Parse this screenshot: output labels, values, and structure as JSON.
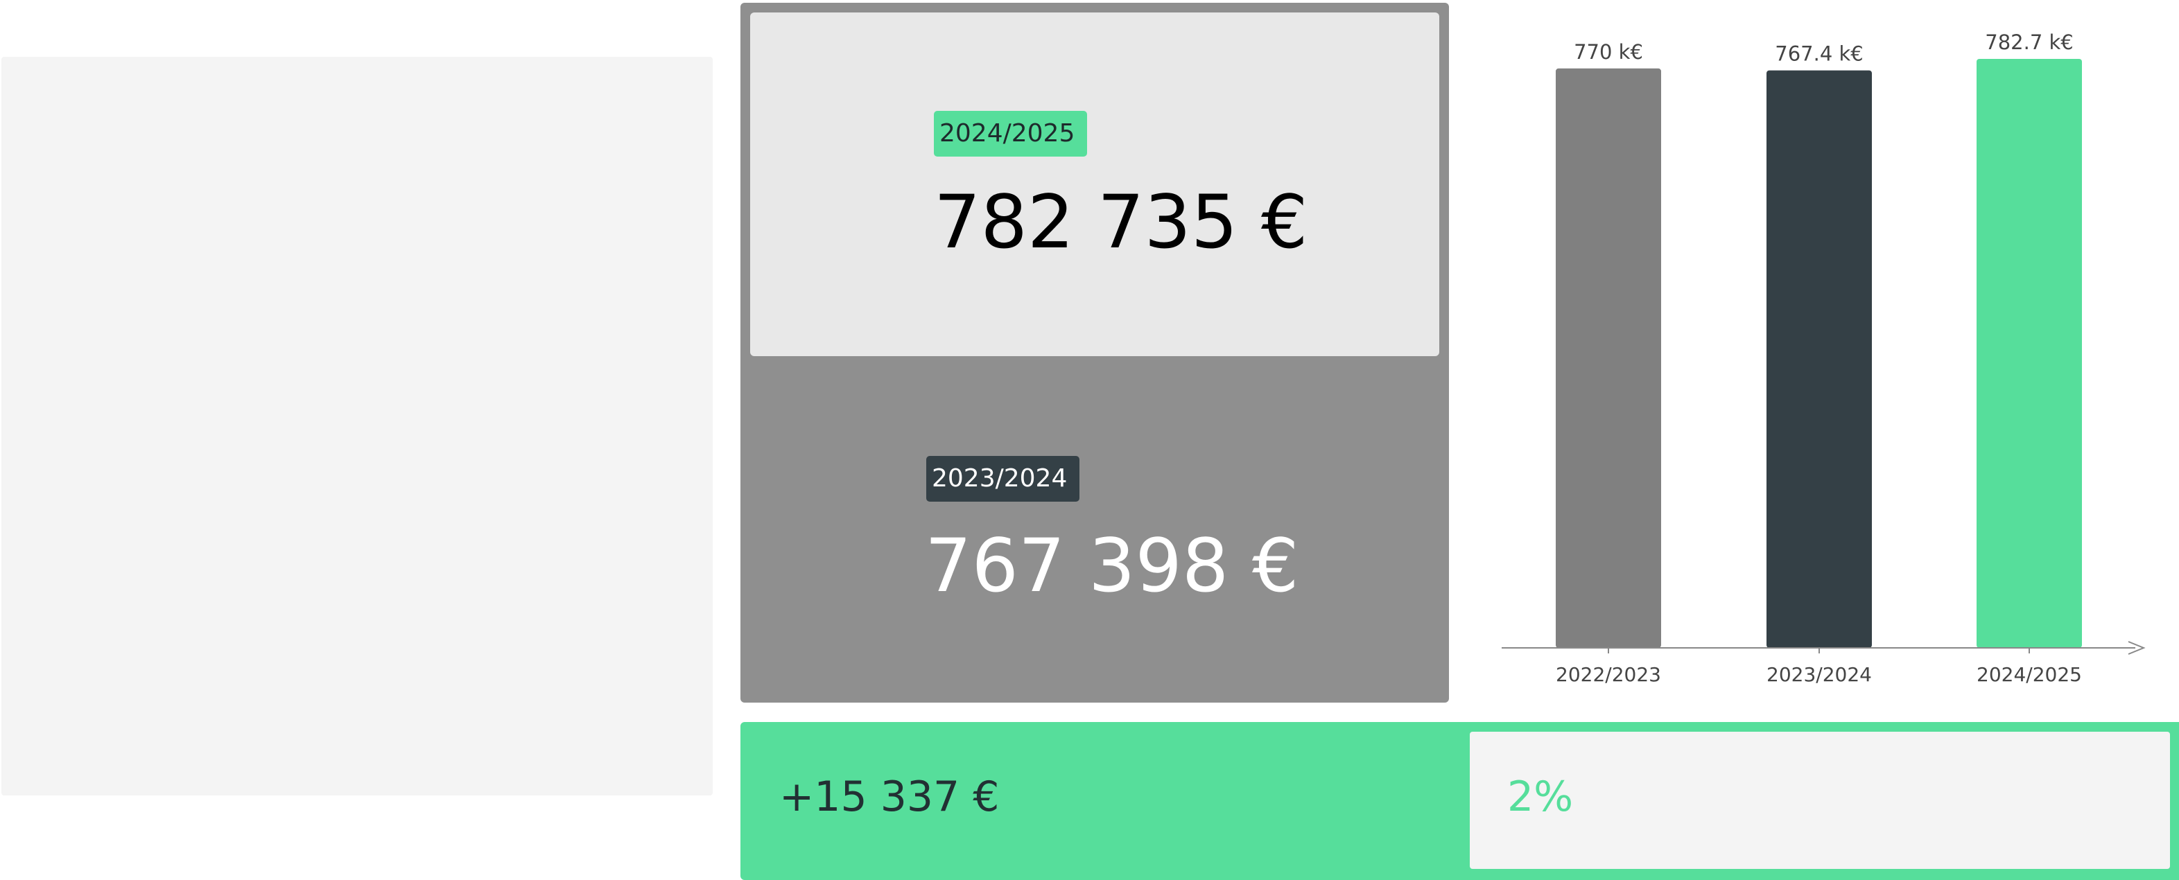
{
  "kpi": {
    "current": {
      "period": "2024/2025",
      "amount": "782 735 €"
    },
    "previous": {
      "period": "2023/2024",
      "amount": "767 398 €"
    },
    "delta": {
      "amount": "+15 337 €",
      "percent": "2%"
    }
  },
  "colors": {
    "accent": "#56de9b",
    "dark": "#344046",
    "grey": "#808080",
    "panel": "#8f8f8f",
    "card": "#e8e8e8",
    "placeholder": "#f4f4f4"
  },
  "chart_data": {
    "type": "bar",
    "categories": [
      "2022/2023",
      "2023/2024",
      "2024/2025"
    ],
    "values": [
      770.0,
      767.4,
      782.7
    ],
    "data_labels": [
      "770 k€",
      "767.4 k€",
      "782.7 k€"
    ],
    "bar_colors": [
      "#808080",
      "#344046",
      "#56de9b"
    ],
    "unit": "k€",
    "ylim": [
      0,
      782.7
    ],
    "grid": false,
    "legend": "none"
  }
}
